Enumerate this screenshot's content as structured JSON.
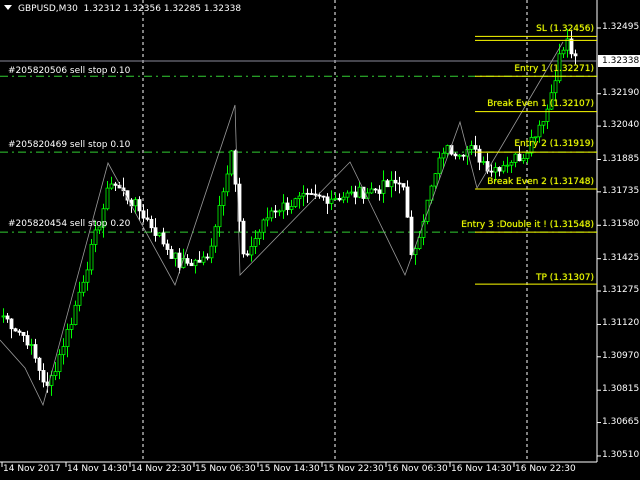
{
  "header": {
    "symbol": "GBPUSD,M30",
    "open": "1.32312",
    "high": "1.32356",
    "low": "1.32285",
    "close": "1.32338"
  },
  "current_price": "1.32338",
  "orders": [
    {
      "label": "#205820506 sell stop 0.10",
      "price": 1.32271
    },
    {
      "label": "#205820469 sell stop 0.10",
      "price": 1.31919
    },
    {
      "label": "#205820454 sell stop 0.20",
      "price": 1.31548
    }
  ],
  "levels": [
    {
      "label": "SL (1.32456)",
      "price": 1.32456
    },
    {
      "label": "Entry 1 (1.32271)",
      "price": 1.32271
    },
    {
      "label": "Break Even 1 (1.32107)",
      "price": 1.32107
    },
    {
      "label": "Entry 2 (1.31919)",
      "price": 1.31919
    },
    {
      "label": "Break Even 2 (1.31748)",
      "price": 1.31748
    },
    {
      "label": "Entry 3 :Double it ! (1.31548)",
      "price": 1.31548
    },
    {
      "label": "TP (1.31307)",
      "price": 1.31307
    }
  ],
  "price_axis": [
    "1.32495",
    "1.32190",
    "1.32040",
    "1.31885",
    "1.31735",
    "1.31580",
    "1.31425",
    "1.31275",
    "1.31120",
    "1.30970",
    "1.30815",
    "1.30665",
    "1.30510"
  ],
  "time_axis": [
    "14 Nov 2017",
    "14 Nov 14:30",
    "14 Nov 22:30",
    "15 Nov 06:30",
    "15 Nov 14:30",
    "15 Nov 22:30",
    "16 Nov 06:30",
    "16 Nov 14:30",
    "16 Nov 22:30"
  ],
  "price_path": [
    [
      0,
      1.3116
    ],
    [
      6,
      1.3105
    ],
    [
      11,
      1.3082
    ],
    [
      17,
      1.3114
    ],
    [
      27,
      1.3179
    ],
    [
      35,
      1.3163
    ],
    [
      44,
      1.314
    ],
    [
      51,
      1.3142
    ],
    [
      57,
      1.3193
    ],
    [
      60,
      1.3142
    ],
    [
      67,
      1.3165
    ],
    [
      75,
      1.317
    ],
    [
      87,
      1.3172
    ],
    [
      100,
      1.3178
    ],
    [
      102,
      1.3142
    ],
    [
      107,
      1.3175
    ],
    [
      110,
      1.3193
    ],
    [
      117,
      1.3193
    ],
    [
      122,
      1.3184
    ],
    [
      130,
      1.3191
    ],
    [
      136,
      1.3212
    ],
    [
      139,
      1.3236
    ],
    [
      141,
      1.3243
    ],
    [
      143,
      1.3234
    ]
  ],
  "colors": {
    "bull": "#00ff00",
    "bear": "#ffffff",
    "order_line": "#32cd32",
    "level_line": "#ffff00"
  }
}
